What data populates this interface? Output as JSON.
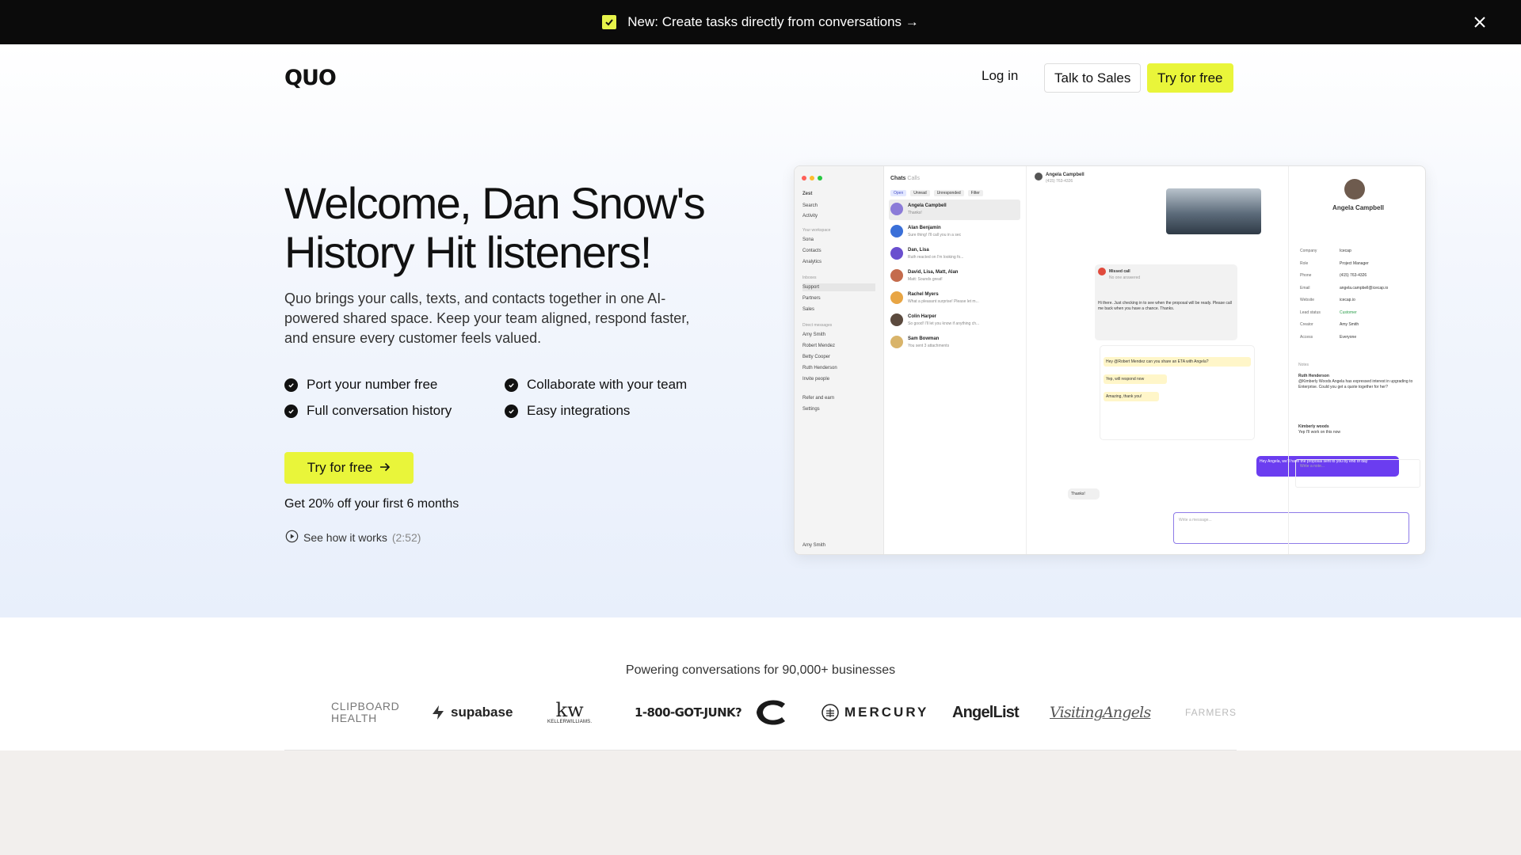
{
  "announcement": {
    "text": "New: Create tasks directly from conversations →",
    "close_icon": "close-icon",
    "check_icon": "checkbox-icon"
  },
  "nav": {
    "logo": "QUO",
    "login": "Log in",
    "sales": "Talk to Sales",
    "try": "Try for free"
  },
  "hero": {
    "title": "Welcome, Dan Snow's History Hit listeners!",
    "description": "Quo brings your calls, texts, and contacts together in one AI-powered shared space. Keep your team aligned, respond faster, and ensure every customer feels valued.",
    "features": [
      "Port your number free",
      "Collaborate with your team",
      "Full conversation history",
      "Easy integrations"
    ],
    "cta": "Try for free",
    "discount": "Get 20% off your first 6 months",
    "video_label": "See how it works",
    "video_duration": "(2:52)"
  },
  "app": {
    "sidebar": {
      "workspace": "Zest",
      "items": [
        "Search",
        "Activity",
        "Sona",
        "Contacts",
        "Analytics",
        "Support",
        "Partners",
        "Sales"
      ],
      "workspace_head": "Your workspace",
      "inboxes_head": "Inboxes",
      "dm_head": "Direct messages",
      "people": [
        "Amy Smith",
        "Robert Mendez",
        "Betty Cooper",
        "Ruth Henderson",
        "Invite people"
      ],
      "footer": [
        "Refer and earn",
        "Settings"
      ],
      "user": "Amy Smith"
    },
    "list": {
      "title": "Chats",
      "title2": "Calls",
      "chips": [
        "Open",
        "Unread",
        "Unresponded",
        "Filter"
      ],
      "conversations": [
        {
          "name": "Angela Campbell",
          "msg": "Thanks!",
          "color": "#8b7bd8"
        },
        {
          "name": "Alan Benjamin",
          "msg": "Sure thing! I'll call you in a sec",
          "color": "#3a6fd8"
        },
        {
          "name": "Dan, Lisa",
          "msg": "Ruth reacted on I'm looking fo...",
          "color": "#6a4fcf"
        },
        {
          "name": "David, Lisa, Matt, Alan",
          "msg": "Matt: Sounds great!",
          "color": "#c46b4c"
        },
        {
          "name": "Rachel Myers",
          "msg": "What a pleasant surprise! Please let m...",
          "color": "#e8a544"
        },
        {
          "name": "Colin Harper",
          "msg": "So good! I'll let you know if anything ch...",
          "color": "#5b4a3e"
        },
        {
          "name": "Sam Bowman",
          "msg": "You sent 3 attachments",
          "color": "#d9b46a"
        }
      ]
    },
    "chat": {
      "contact": "Angela Campbell",
      "phone": "(415) 763-4326",
      "missed_call": "Missed call",
      "no_answer": "No one answered",
      "voicemail": "Hi there. Just checking in to see when the proposal will be ready. Please call me back when you have a chance. Thanks.",
      "thread_1": "Hey @Robert Mendez can you share an ETA with Angela?",
      "thread_2": "Yep, will respond now",
      "thread_3": "Amazing, thank you!",
      "outgoing": "Hey Angela, we'll have the proposal sent to you by end of day",
      "incoming": "Thanks!",
      "input_placeholder": "Write a message..."
    },
    "detail": {
      "name": "Angela Campbell",
      "fields": [
        {
          "k": "Company",
          "v": "Icecap"
        },
        {
          "k": "Role",
          "v": "Project Manager"
        },
        {
          "k": "Phone",
          "v": "(415) 763-4326"
        },
        {
          "k": "Email",
          "v": "angela.campbell@icecap.io"
        },
        {
          "k": "Website",
          "v": "icecap.io"
        },
        {
          "k": "Lead status",
          "v": "Customer"
        },
        {
          "k": "Creator",
          "v": "Amy Smith"
        },
        {
          "k": "Access",
          "v": "Everyone"
        }
      ],
      "notes_head": "Notes",
      "note_1_author": "Ruth Henderson",
      "note_1": "@Kimberly Woods Angela has expressed interest in upgrading to Enterprise. Could you get a quote together for her?",
      "note_2_author": "Kimberly woods",
      "note_2": "Yep I'll work on this now",
      "note_input": "Write a note..."
    }
  },
  "logos_section": {
    "headline": "Powering conversations for 90,000+ businesses",
    "logos": [
      "CLIPBOARD HEALTH",
      "supabase",
      "KELLERWILLIAMS.",
      "1-800-GOT-JUNK?",
      "MERCURY",
      "AngelList",
      "VisitingAngels",
      "FARMERS"
    ]
  },
  "colors": {
    "accent": "#e9f53a",
    "dark": "#0b0b0b",
    "purple": "#6b3df0"
  }
}
